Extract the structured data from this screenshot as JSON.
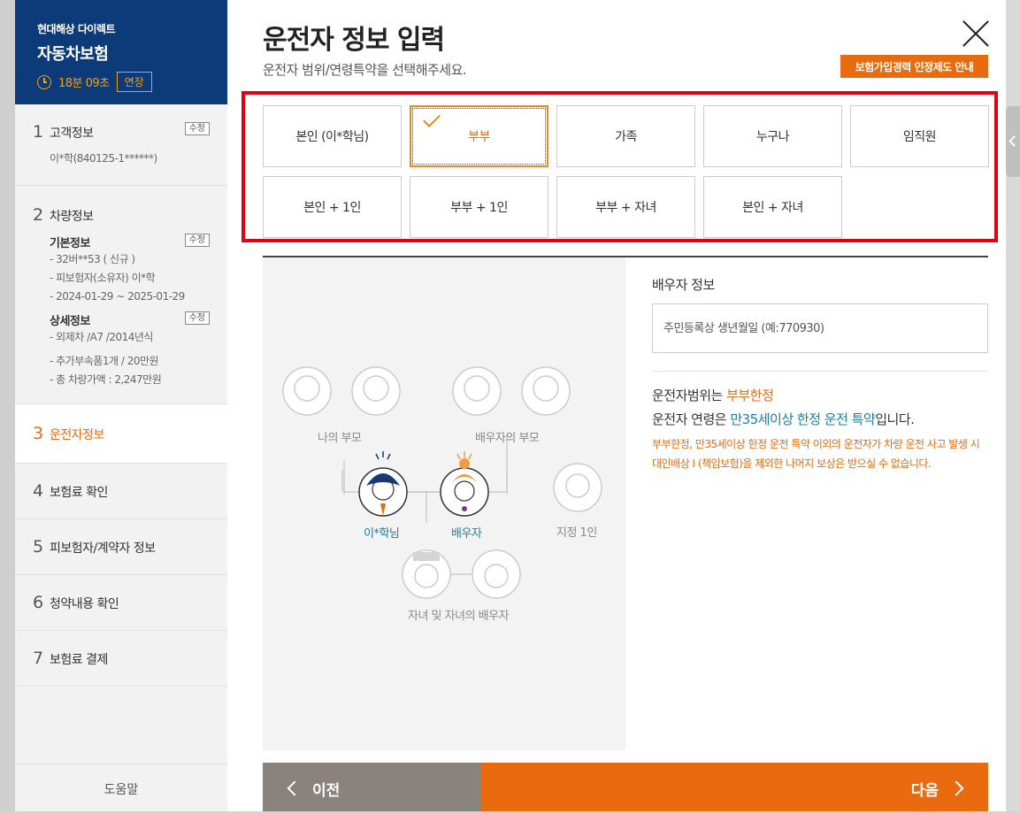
{
  "sidebar": {
    "brand": "현대해상 다이렉트",
    "product": "자동차보험",
    "timer": "18분 09초",
    "extend_label": "연장",
    "help_label": "도움말",
    "edit_label": "수정",
    "steps": [
      {
        "num": "1",
        "label": "고객정보",
        "detail": "이*학(840125-1******)"
      },
      {
        "num": "2",
        "label": "차량정보",
        "basic_head": "기본정보",
        "basic_lines": [
          "- 32버**53 ( 신규 )",
          "- 피보험자(소유자) 이*학",
          "- 2024-01-29 ~ 2025-01-29"
        ],
        "detail_head": "상세정보",
        "detail_lines": [
          "- 외제차 /A7 /2014년식",
          "- 추가부속품1개 / 20만원",
          "- 총 차량가액 : 2,247만원"
        ]
      },
      {
        "num": "3",
        "label": "운전자정보"
      },
      {
        "num": "4",
        "label": "보험료 확인"
      },
      {
        "num": "5",
        "label": "피보험자/계약자 정보"
      },
      {
        "num": "6",
        "label": "청약내용 확인"
      },
      {
        "num": "7",
        "label": "보험료 결제"
      }
    ]
  },
  "main": {
    "title": "운전자 정보 입력",
    "subtitle": "운전자 범위/연령특약을 선택해주세요.",
    "guide_button": "보험가입경력 인정제도 안내",
    "options": [
      "본인 (이*학님)",
      "부부",
      "가족",
      "누구나",
      "임직원",
      "본인 + 1인",
      "부부 + 1인",
      "부부 + 자녀",
      "본인 + 자녀"
    ],
    "selected_option": "부부",
    "illustration": {
      "my_parents": "나의 부모",
      "spouse_parents": "배우자의 부모",
      "me": "이*학님",
      "spouse": "배우자",
      "designated": "지정 1인",
      "children": "자녀 및 자녀의 배우자"
    },
    "spouse_info_label": "배우자 정보",
    "birth_placeholder": "주민등록상 생년월일 (예:770930)",
    "summary_line1_pre": "운전자범위는 ",
    "summary_line1_hl": "부부한정",
    "summary_line2_pre": "운전자 연령은 ",
    "summary_line2_hl": "만35세이상 한정 운전 특약",
    "summary_line2_post": "입니다.",
    "notice": "부부한정, 만35세이상 한정 운전 특약 이외의 운전자가 차량 운전 사고 발생 시 대인배상 Ⅰ (책임보험)을 제외한 나머지 보상은 받으실 수 없습니다.",
    "prev_label": "이전",
    "next_label": "다음"
  },
  "colors": {
    "brand_navy": "#0d3a78",
    "accent_orange": "#ea6a10",
    "highlight_frame": "#e00010",
    "link_blue": "#1a7ea8"
  }
}
